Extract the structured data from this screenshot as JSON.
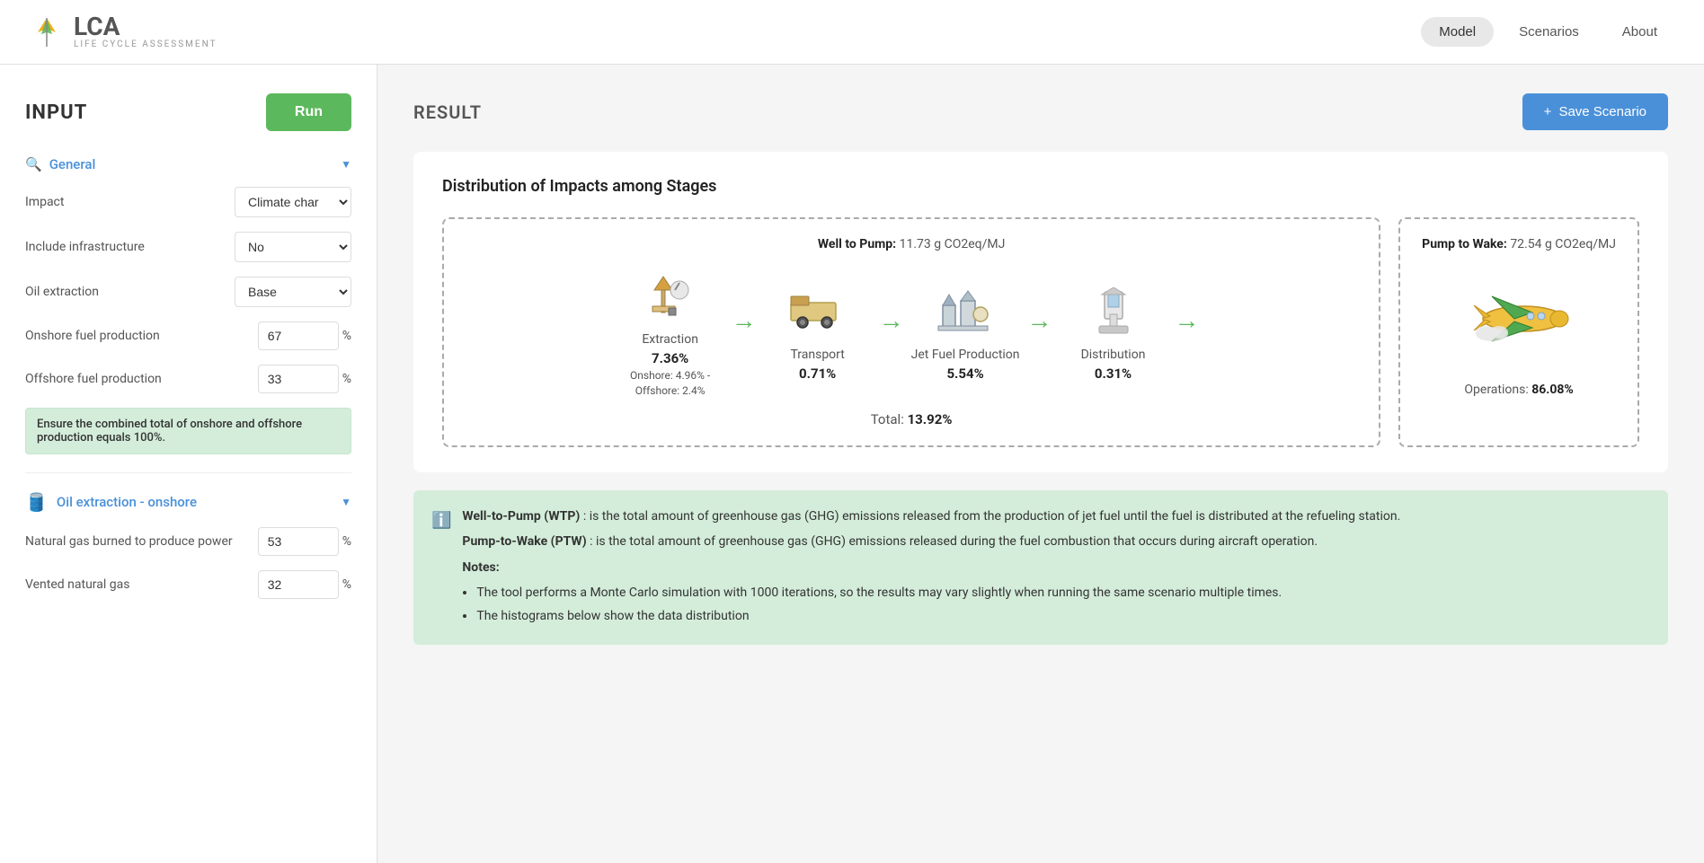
{
  "header": {
    "logo_lca": "LCA",
    "logo_subtitle": "LIFE CYCLE ASSESSMENT",
    "nav": {
      "model": "Model",
      "scenarios": "Scenarios",
      "about": "About"
    }
  },
  "input": {
    "title": "INPUT",
    "run_button": "Run",
    "general": {
      "section_label": "General",
      "impact_label": "Impact",
      "impact_value": "Climate char",
      "include_infra_label": "Include infrastructure",
      "include_infra_value": "No",
      "oil_extraction_label": "Oil extraction",
      "oil_extraction_value": "Base",
      "onshore_fuel_label": "Onshore fuel production",
      "onshore_fuel_value": "67",
      "offshore_fuel_label": "Offshore fuel production",
      "offshore_fuel_value": "33",
      "warning": "Ensure the combined total of onshore and offshore production equals 100%."
    },
    "oil_extraction_onshore": {
      "section_label": "Oil extraction - onshore",
      "natural_gas_label": "Natural gas burned to produce power",
      "natural_gas_value": "53",
      "vented_gas_label": "Vented natural gas",
      "vented_gas_value": "32"
    }
  },
  "result": {
    "title": "RESULT",
    "save_button": "Save Scenario",
    "distribution_title": "Distribution of Impacts among Stages",
    "wtp_label": "Well to Pump:",
    "wtp_value": "11.73 g CO2eq/MJ",
    "ptw_label": "Pump to Wake:",
    "ptw_value": "72.54 g CO2eq/MJ",
    "stages": [
      {
        "name": "Extraction",
        "pct": "7.36%",
        "sub1": "Onshore: 4.96% -",
        "sub2": "Offshore: 2.4%",
        "icon": "🏗️"
      },
      {
        "name": "Transport",
        "pct": "0.71%",
        "sub1": "",
        "sub2": "",
        "icon": "🚛"
      },
      {
        "name": "Jet Fuel Production",
        "pct": "5.54%",
        "sub1": "",
        "sub2": "",
        "icon": "🏭"
      },
      {
        "name": "Distribution",
        "pct": "0.31%",
        "sub1": "",
        "sub2": "",
        "icon": "⛽"
      }
    ],
    "total_label": "Total:",
    "total_value": "13.92%",
    "operations_label": "Operations:",
    "operations_value": "86.08%",
    "info": {
      "wtp_def_label": "Well-to-Pump (WTP)",
      "wtp_def": ": is the total amount of greenhouse gas (GHG) emissions released from the production of jet fuel until the fuel is distributed at the refueling station.",
      "ptw_def_label": "Pump-to-Wake (PTW)",
      "ptw_def": ": is the total amount of greenhouse gas (GHG) emissions released during the fuel combustion that occurs during aircraft operation.",
      "notes_label": "Notes:",
      "note1": "The tool performs a Monte Carlo simulation with 1000 iterations, so the results may vary slightly when running the same scenario multiple times.",
      "note2": "The histograms below show the data distribution"
    }
  }
}
